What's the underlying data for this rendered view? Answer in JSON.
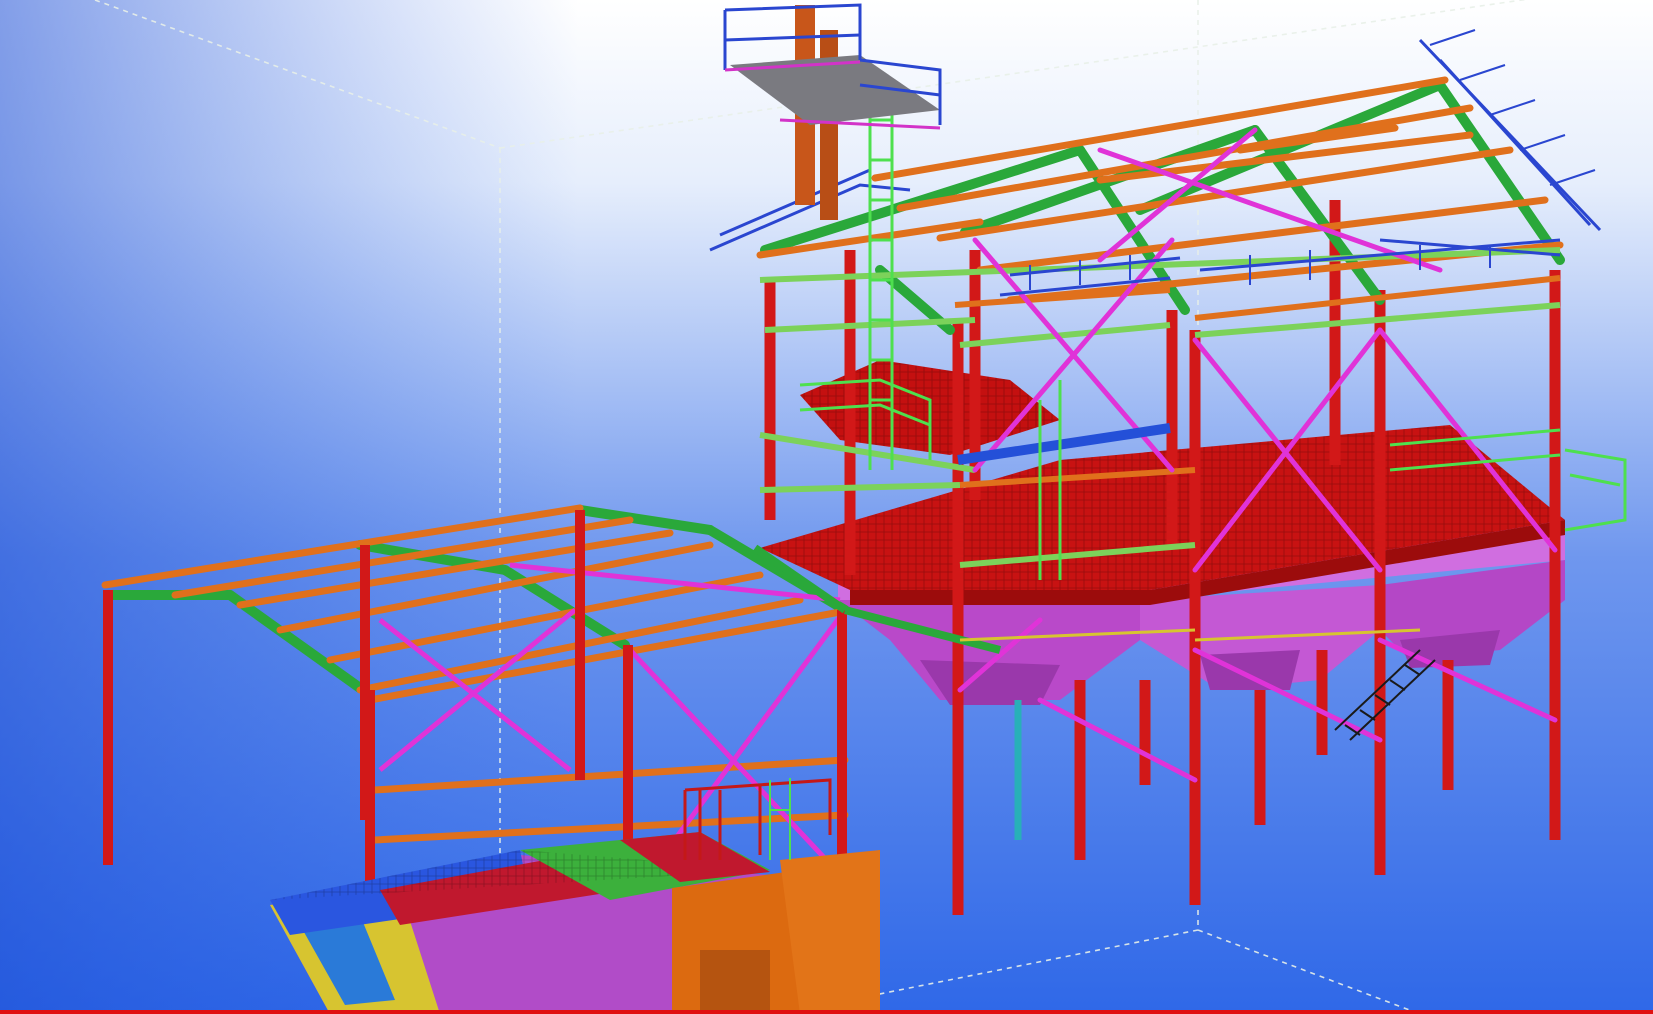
{
  "viewport": {
    "background_top": "#ffffff",
    "background_bottom": "#2f68e8",
    "colors": {
      "column": "#d61a1a",
      "rafter": "#2aa83a",
      "purlin": "#e0701c",
      "bracing": "#e033d8",
      "handrail": "#2a46d0",
      "railing_green": "#4ee04e",
      "hopper": "#c050d0",
      "floor": "#c41010",
      "work_area_line": "#e8e8e8",
      "box": "#dc6a10",
      "bottom_bar": "#e01010"
    },
    "icons": [
      "steel-structure-model",
      "view-navigation-box"
    ]
  }
}
